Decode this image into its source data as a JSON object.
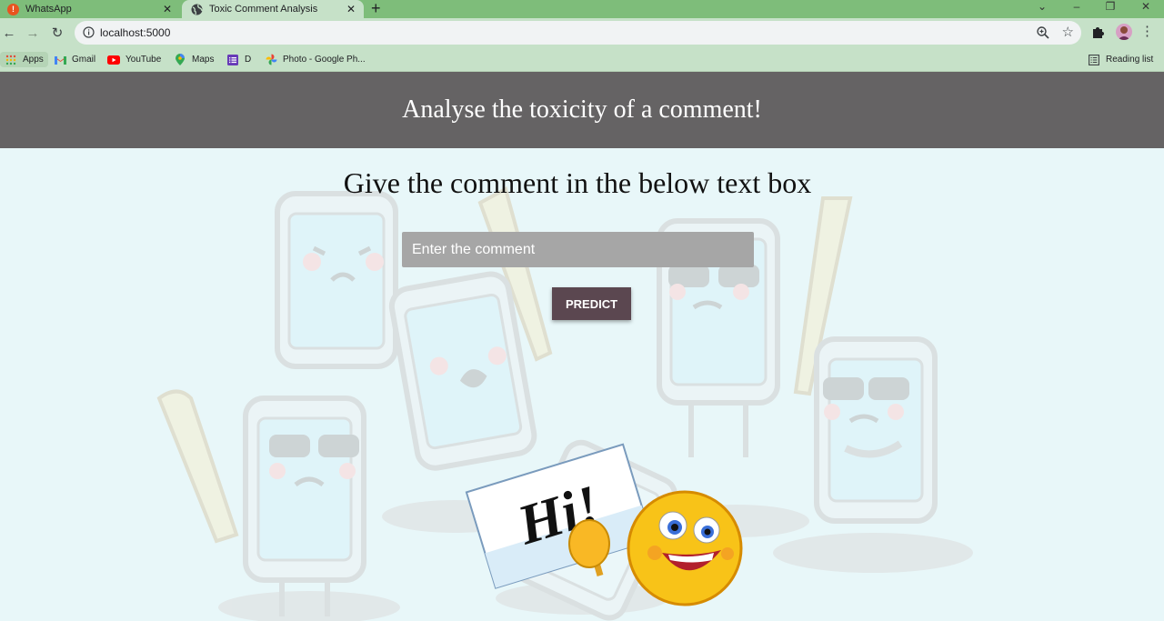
{
  "browser": {
    "tabs": [
      {
        "title": "WhatsApp",
        "active": false,
        "icon": "whatsapp-icon"
      },
      {
        "title": "Toxic Comment Analysis",
        "active": true,
        "icon": "globe-icon"
      }
    ],
    "url": "localhost:5000",
    "bookmarks": [
      {
        "label": "Apps",
        "icon": "apps-grid-icon"
      },
      {
        "label": "Gmail",
        "icon": "gmail-icon"
      },
      {
        "label": "YouTube",
        "icon": "youtube-icon"
      },
      {
        "label": "Maps",
        "icon": "maps-pin-icon"
      },
      {
        "label": "D",
        "icon": "forms-icon"
      },
      {
        "label": "Photo - Google Ph...",
        "icon": "photos-pinwheel-icon"
      }
    ],
    "reading_list": "Reading list"
  },
  "page": {
    "header_title": "Analyse the toxicity of a comment!",
    "subtitle": "Give the comment in the below text box",
    "comment_placeholder": "Enter the comment",
    "predict_label": "PREDICT",
    "sign_text": "Hi!"
  },
  "colors": {
    "tab_strip": "#7ebd7a",
    "toolbar": "#c6e1c8",
    "header_bg": "#656364",
    "page_bg": "#e8f7f9",
    "input_bg": "#a6a6a6",
    "button_bg": "#5b4750"
  }
}
